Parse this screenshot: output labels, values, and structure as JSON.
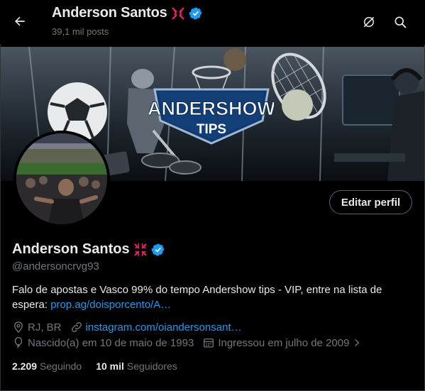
{
  "header": {
    "name": "Anderson Santos",
    "posts": "39,1 mil posts"
  },
  "banner": {
    "logo_line1": "ANDERSHOW",
    "logo_line2": "TIPS"
  },
  "profile": {
    "name": "Anderson Santos",
    "handle": "@andersoncrvg93",
    "bio_text": "Falo de apostas e Vasco 99% do tempo  Andershow tips - VIP, entre na lista de espera: ",
    "bio_link": "prop.ag/doisporcento/A…",
    "location": "RJ, BR",
    "website": "instagram.com/oiandersonsant…",
    "birthday": "Nascido(a) em 10 de maio de 1993",
    "joined": "Ingressou em julho de 2009",
    "following_count": "2.209",
    "following_label": "Seguindo",
    "followers_count": "10 mil",
    "followers_label": "Seguidores"
  },
  "actions": {
    "edit_profile": "Editar perfil"
  },
  "colors": {
    "accent": "#1d9bf0",
    "verified": "#1d9bf0",
    "emoji_red": "#e0245e",
    "muted": "#71767b"
  },
  "icons": [
    "back-arrow-icon",
    "hide-icon",
    "search-icon",
    "verified-badge-icon",
    "anger-emoji-icon",
    "location-icon",
    "link-icon",
    "balloon-icon",
    "calendar-icon",
    "chevron-right-icon"
  ]
}
